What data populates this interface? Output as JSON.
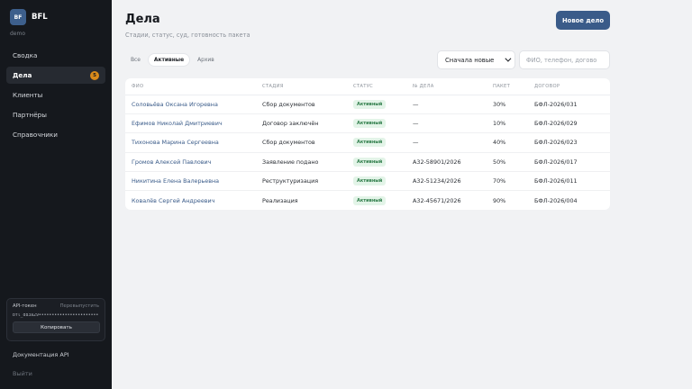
{
  "sidebar": {
    "logo_text": "BF",
    "brand": "BFL",
    "workspace": "demo",
    "items": [
      {
        "label": "Сводка",
        "active": false
      },
      {
        "label": "Дела",
        "active": true,
        "badge": "5"
      },
      {
        "label": "Клиенты",
        "active": false
      },
      {
        "label": "Партнёры",
        "active": false
      },
      {
        "label": "Справочники",
        "active": false
      }
    ],
    "token": {
      "label": "API-токен",
      "reissue": "Перевыпустить",
      "value": "bfl_d83a29•••••••••••••••••••••••",
      "copy": "Копировать"
    },
    "api_docs": "Документация API",
    "logout": "Выйти"
  },
  "header": {
    "title": "Дела",
    "subtitle": "Стадии, статус, суд, готовность пакета",
    "new_button": "Новое дело"
  },
  "filters": {
    "tabs": [
      {
        "label": "Все",
        "active": false
      },
      {
        "label": "Активные",
        "active": true
      },
      {
        "label": "Архив",
        "active": false
      }
    ],
    "sort_value": "Сначала новые",
    "search_placeholder": "ФИО, телефон, догово"
  },
  "table": {
    "columns": [
      "ФИО",
      "СТАДИЯ",
      "СТАТУС",
      "№ ДЕЛА",
      "ПАКЕТ",
      "ДОГОВОР"
    ],
    "rows": [
      {
        "name": "Соловьёва Оксана Игоревна",
        "stage": "Сбор документов",
        "status": "Активный",
        "case": "—",
        "pack": "30%",
        "contract": "БФЛ-2026/031"
      },
      {
        "name": "Ефимов Николай Дмитриевич",
        "stage": "Договор заключён",
        "status": "Активный",
        "case": "—",
        "pack": "10%",
        "contract": "БФЛ-2026/029"
      },
      {
        "name": "Тихонова Марина Сергеевна",
        "stage": "Сбор документов",
        "status": "Активный",
        "case": "—",
        "pack": "40%",
        "contract": "БФЛ-2026/023"
      },
      {
        "name": "Громов Алексей Павлович",
        "stage": "Заявление подано",
        "status": "Активный",
        "case": "А32-58901/2026",
        "pack": "50%",
        "contract": "БФЛ-2026/017"
      },
      {
        "name": "Никитина Елена Валерьевна",
        "stage": "Реструктуризация",
        "status": "Активный",
        "case": "А32-51234/2026",
        "pack": "70%",
        "contract": "БФЛ-2026/011"
      },
      {
        "name": "Ковалёв Сергей Андреевич",
        "stage": "Реализация",
        "status": "Активный",
        "case": "А32-45671/2026",
        "pack": "90%",
        "contract": "БФЛ-2026/004"
      }
    ]
  },
  "colors": {
    "sidebar_bg": "#15181d",
    "accent": "#3a5b89",
    "badge": "#d98a1a",
    "status_bg": "#e3f4e8",
    "status_text": "#2f7d4a"
  }
}
